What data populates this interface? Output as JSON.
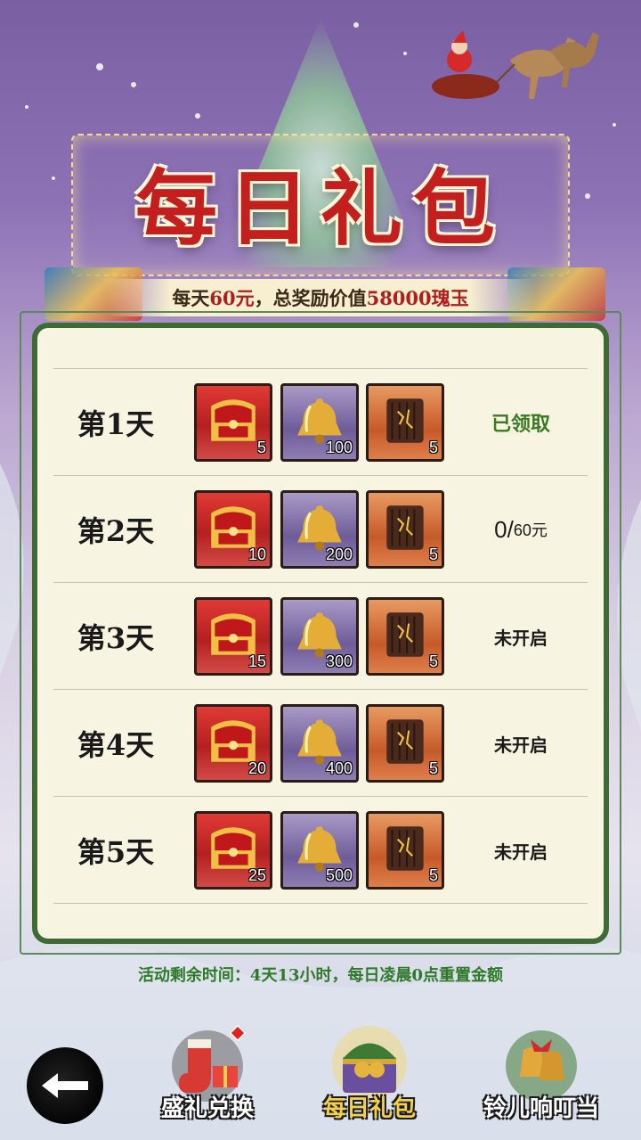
{
  "header": {
    "title": "每日礼包",
    "subtitle_prefix": "每天",
    "subtitle_price": "60元",
    "subtitle_mid": "，总奖励价值",
    "subtitle_value": "58000瑰玉"
  },
  "rewards": [
    {
      "day": "第1天",
      "items": [
        {
          "icon": "red-chest-icon",
          "count": "5"
        },
        {
          "icon": "bell-icon",
          "count": "100"
        },
        {
          "icon": "scroll-icon",
          "count": "5"
        }
      ],
      "status": "已领取",
      "state": "claimed"
    },
    {
      "day": "第2天",
      "items": [
        {
          "icon": "red-chest-icon",
          "count": "10"
        },
        {
          "icon": "bell-icon",
          "count": "200"
        },
        {
          "icon": "scroll-icon",
          "count": "5"
        }
      ],
      "status_main": "0/",
      "status_small": "60元",
      "state": "progress"
    },
    {
      "day": "第3天",
      "items": [
        {
          "icon": "red-chest-icon",
          "count": "15"
        },
        {
          "icon": "bell-icon",
          "count": "300"
        },
        {
          "icon": "scroll-icon",
          "count": "5"
        }
      ],
      "status": "未开启",
      "state": "locked"
    },
    {
      "day": "第4天",
      "items": [
        {
          "icon": "red-chest-icon",
          "count": "20"
        },
        {
          "icon": "bell-icon",
          "count": "400"
        },
        {
          "icon": "scroll-icon",
          "count": "5"
        }
      ],
      "status": "未开启",
      "state": "locked"
    },
    {
      "day": "第5天",
      "items": [
        {
          "icon": "red-chest-icon",
          "count": "25"
        },
        {
          "icon": "bell-icon",
          "count": "500"
        },
        {
          "icon": "scroll-icon",
          "count": "5"
        }
      ],
      "status": "未开启",
      "state": "locked"
    }
  ],
  "footer_note": "活动剩余时间：4天13小时，每日凌晨0点重置金额",
  "nav": {
    "back_icon": "back-arrow-icon",
    "tabs": [
      {
        "label": "盛礼兑换",
        "icon": "gift-socks-icon",
        "active": false
      },
      {
        "label": "每日礼包",
        "icon": "gift-chest-icon",
        "active": true
      },
      {
        "label": "铃儿响叮当",
        "icon": "jingle-bells-icon",
        "active": false
      }
    ]
  },
  "colors": {
    "panel_border": "#3e6b34",
    "claimed_text": "#3a7a22",
    "title_red": "#c41f1f",
    "active_tab": "#f4cf4a"
  }
}
